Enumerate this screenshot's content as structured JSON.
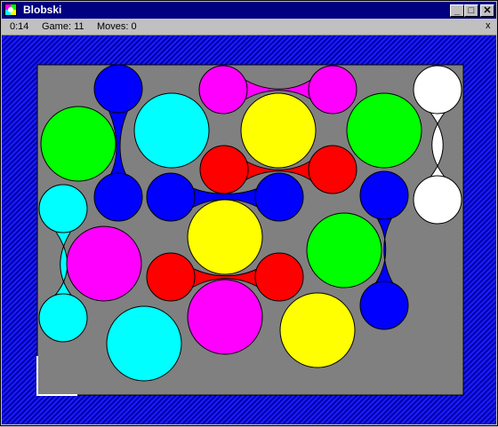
{
  "window": {
    "title": "Blobski"
  },
  "status": {
    "time": "0:14",
    "game": "Game: 11",
    "moves": "Moves: 0",
    "close_label": "x"
  },
  "controls": {
    "minimize": "_",
    "maximize": "□",
    "close": "✕"
  },
  "colors": {
    "blue": "#0000ff",
    "cyan": "#00ffff",
    "magenta": "#ff00ff",
    "yellow": "#ffff00",
    "green": "#00ff00",
    "red": "#ff0000",
    "white": "#ffffff",
    "board": "#808080"
  },
  "blobs": [
    {
      "name": "blue-pair-top-left",
      "color": "blue"
    },
    {
      "name": "magenta-pair-top",
      "color": "magenta"
    },
    {
      "name": "white-pair-right",
      "color": "white"
    },
    {
      "name": "red-pair-upper",
      "color": "red"
    },
    {
      "name": "blue-pair-middle",
      "color": "blue"
    },
    {
      "name": "cyan-pair-left",
      "color": "cyan"
    },
    {
      "name": "blue-pair-right",
      "color": "blue"
    },
    {
      "name": "red-pair-lower",
      "color": "red"
    }
  ],
  "circles": [
    {
      "name": "green-circle-left",
      "color": "green"
    },
    {
      "name": "cyan-circle-top",
      "color": "cyan"
    },
    {
      "name": "yellow-circle-top",
      "color": "yellow"
    },
    {
      "name": "green-circle-top-right",
      "color": "green"
    },
    {
      "name": "yellow-circle-center",
      "color": "yellow"
    },
    {
      "name": "green-circle-right",
      "color": "green"
    },
    {
      "name": "magenta-circle-left",
      "color": "magenta"
    },
    {
      "name": "magenta-circle-bottom",
      "color": "magenta"
    },
    {
      "name": "cyan-circle-bottom",
      "color": "cyan"
    },
    {
      "name": "yellow-circle-bottom",
      "color": "yellow"
    }
  ]
}
